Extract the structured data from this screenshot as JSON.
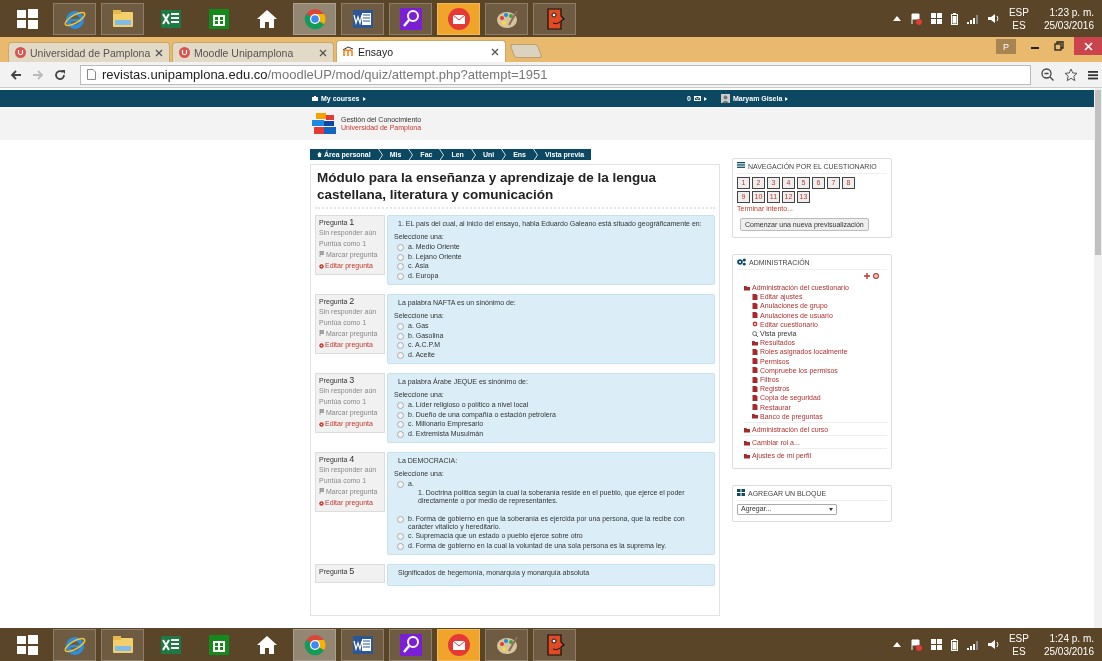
{
  "taskbar_top": {
    "apps": [
      {
        "kind": "windows",
        "open": false,
        "active": false,
        "flashing": false
      },
      {
        "kind": "ie",
        "open": true,
        "active": false,
        "flashing": false
      },
      {
        "kind": "explorer",
        "open": true,
        "active": false,
        "flashing": false
      },
      {
        "kind": "excel",
        "open": false,
        "active": false,
        "flashing": false
      },
      {
        "kind": "store",
        "open": false,
        "active": false,
        "flashing": false
      },
      {
        "kind": "home",
        "open": false,
        "active": false,
        "flashing": false
      },
      {
        "kind": "chrome",
        "open": true,
        "active": true,
        "flashing": false
      },
      {
        "kind": "word",
        "open": true,
        "active": false,
        "flashing": false
      },
      {
        "kind": "search",
        "open": true,
        "active": false,
        "flashing": false
      },
      {
        "kind": "mail",
        "open": true,
        "active": false,
        "flashing": true
      },
      {
        "kind": "paint",
        "open": true,
        "active": false,
        "flashing": false
      },
      {
        "kind": "face",
        "open": true,
        "active": false,
        "flashing": false
      }
    ],
    "language": "ESP",
    "keyboard": "ES",
    "time": "1:23 p. m.",
    "date": "25/03/2016"
  },
  "browser": {
    "tabs": [
      {
        "title": "Universidad de Pamplona",
        "kind": "university",
        "selected": false
      },
      {
        "title": "Moodle Unipamplona",
        "kind": "university",
        "selected": false
      },
      {
        "title": "Ensayo",
        "kind": "moodle",
        "selected": true
      }
    ],
    "profile": "P",
    "url_host": "revistas.unipamplona.edu.co",
    "url_path": "/moodleUP/mod/quiz/attempt.php?attempt=1951"
  },
  "navbar": {
    "my_courses": "My courses",
    "messages": "0",
    "user_name": "Maryam Gisela"
  },
  "logo": {
    "line1": "Gestión del Conocimiento",
    "line2": "Universidad de Pamplona"
  },
  "breadcrumb": [
    "Área personal",
    "Mis",
    "Fac",
    "Len",
    "Uni",
    "Ens",
    "Vista previa"
  ],
  "quiz_title": "Módulo para la enseñanza y aprendizaje de la lengua castellana, literatura y comunicación",
  "questions": [
    {
      "label": "Pregunta",
      "number": "1",
      "status": "Sin responder aún",
      "marks": "Puntúa como 1",
      "flag": "Marcar pregunta",
      "edit": "Editar pregunta",
      "text": "1. EL país del cual, al inicio del ensayo, habla Eduardo Galeano está situado geográficamente en:",
      "prompt": "Seleccione una:",
      "options": [
        {
          "text": "a. Medio Oriente",
          "selected": false
        },
        {
          "text": "b. Lejano Oriente",
          "selected": false
        },
        {
          "text": "c. Asia",
          "selected": false
        },
        {
          "text": "d. Europa",
          "selected": false
        }
      ]
    },
    {
      "label": "Pregunta",
      "number": "2",
      "status": "Sin responder aún",
      "marks": "Puntúa como 1",
      "flag": "Marcar pregunta",
      "edit": "Editar pregunta",
      "text": "La palabra NAFTA es un sinónimo de:",
      "prompt": "Seleccione una:",
      "options": [
        {
          "text": "a. Gas",
          "selected": false
        },
        {
          "text": "b. Gasolina",
          "selected": false
        },
        {
          "text": "c. A.C.P.M",
          "selected": false
        },
        {
          "text": "d. Aceite",
          "selected": false
        }
      ]
    },
    {
      "label": "Pregunta",
      "number": "3",
      "status": "Sin responder aún",
      "marks": "Puntúa como 1",
      "flag": "Marcar pregunta",
      "edit": "Editar pregunta",
      "text": "La palabra Árabe JEQUE es sinónimo de:",
      "prompt": "Seleccione una:",
      "options": [
        {
          "text": "a. Líder religioso o político a nivel local",
          "selected": false
        },
        {
          "text": "b. Dueño de una compañía o estación petrolera",
          "selected": false
        },
        {
          "text": "c. Millonario Empresario",
          "selected": false
        },
        {
          "text": "d. Extremista Musulmán",
          "selected": false
        }
      ]
    },
    {
      "label": "Pregunta",
      "number": "4",
      "status": "Sin responder aún",
      "marks": "Puntúa como 1",
      "flag": "Marcar pregunta",
      "edit": "Editar pregunta",
      "text": "La DEMOCRACIA:",
      "prompt": "Seleccione una:",
      "options": [
        {
          "text": "a.",
          "detail": "1. Doctrina política según la cual la soberanía reside en el pueblo, que ejerce el poder directamente o por medio de representantes.",
          "selected": false
        },
        {
          "text": "b. Forma de gobierno en que la soberanía es ejercida por una persona, que la recibe con carácter vitalicio y hereditario.",
          "selected": false
        },
        {
          "text": "c. Supremacía que un estado o pueblo ejerce sobre otro",
          "selected": false
        },
        {
          "text": "d. Forma de gobierno en la cual la voluntad de una sola persona es la suprema ley.",
          "selected": false
        }
      ]
    },
    {
      "label": "Pregunta",
      "number": "5",
      "text": "Significados de hegemonía, monarquía y monarquía absoluta"
    }
  ],
  "quiz_navigation": {
    "title": "NAVEGACIÓN POR EL CUESTIONARIO",
    "pages": [
      "1",
      "2",
      "3",
      "4",
      "5",
      "6",
      "7",
      "8",
      "9",
      "10",
      "11",
      "12",
      "13"
    ],
    "finish_link": "Terminar intento...",
    "button": "Comenzar una nueva previsualización"
  },
  "administration": {
    "title": "ADMINISTRACIÓN",
    "tree": [
      {
        "label": "Administración del cuestionario",
        "kind": "folder",
        "selected": false,
        "children": [
          {
            "label": "Editar ajustes",
            "kind": "file",
            "selected": false
          },
          {
            "label": "Anulaciones de grupo",
            "kind": "file",
            "selected": false
          },
          {
            "label": "Anulaciones de usuario",
            "kind": "file",
            "selected": false
          },
          {
            "label": "Editar cuestionario",
            "kind": "gear",
            "selected": false
          },
          {
            "label": "Vista previa",
            "kind": "search",
            "selected": true
          },
          {
            "label": "Resultados",
            "kind": "folder",
            "selected": false
          },
          {
            "label": "Roles asignados localmente",
            "kind": "file",
            "selected": false
          },
          {
            "label": "Permisos",
            "kind": "file",
            "selected": false
          },
          {
            "label": "Compruebe los permisos",
            "kind": "file",
            "selected": false
          },
          {
            "label": "Filtros",
            "kind": "file",
            "selected": false
          },
          {
            "label": "Registros",
            "kind": "file",
            "selected": false
          },
          {
            "label": "Copia de seguridad",
            "kind": "file",
            "selected": false
          },
          {
            "label": "Restaurar",
            "kind": "file",
            "selected": false
          },
          {
            "label": "Banco de preguntas",
            "kind": "folder",
            "selected": false
          }
        ]
      },
      {
        "label": "Administración del curso",
        "kind": "folder",
        "selected": false
      },
      {
        "label": "Cambiar rol a...",
        "kind": "folder",
        "selected": false
      },
      {
        "label": "Ajustes de mi perfil",
        "kind": "folder",
        "selected": false
      }
    ]
  },
  "add_block": {
    "title": "AGREGAR UN BLOQUE",
    "select": "Agregar..."
  },
  "taskbar_bottom": {
    "apps": [
      {
        "kind": "windows",
        "open": false,
        "active": false,
        "flashing": false
      },
      {
        "kind": "ie",
        "open": true,
        "active": false,
        "flashing": false
      },
      {
        "kind": "explorer",
        "open": true,
        "active": false,
        "flashing": false
      },
      {
        "kind": "excel",
        "open": false,
        "active": false,
        "flashing": false
      },
      {
        "kind": "store",
        "open": false,
        "active": false,
        "flashing": false
      },
      {
        "kind": "home",
        "open": false,
        "active": false,
        "flashing": false
      },
      {
        "kind": "chrome",
        "open": true,
        "active": true,
        "flashing": false
      },
      {
        "kind": "word",
        "open": true,
        "active": false,
        "flashing": false
      },
      {
        "kind": "search",
        "open": true,
        "active": false,
        "flashing": false
      },
      {
        "kind": "mail",
        "open": true,
        "active": false,
        "flashing": true
      },
      {
        "kind": "paint",
        "open": true,
        "active": false,
        "flashing": false
      },
      {
        "kind": "face",
        "open": true,
        "active": false,
        "flashing": false
      }
    ],
    "language": "ESP",
    "keyboard": "ES",
    "time": "1:24 p. m.",
    "date": "25/03/2016"
  }
}
